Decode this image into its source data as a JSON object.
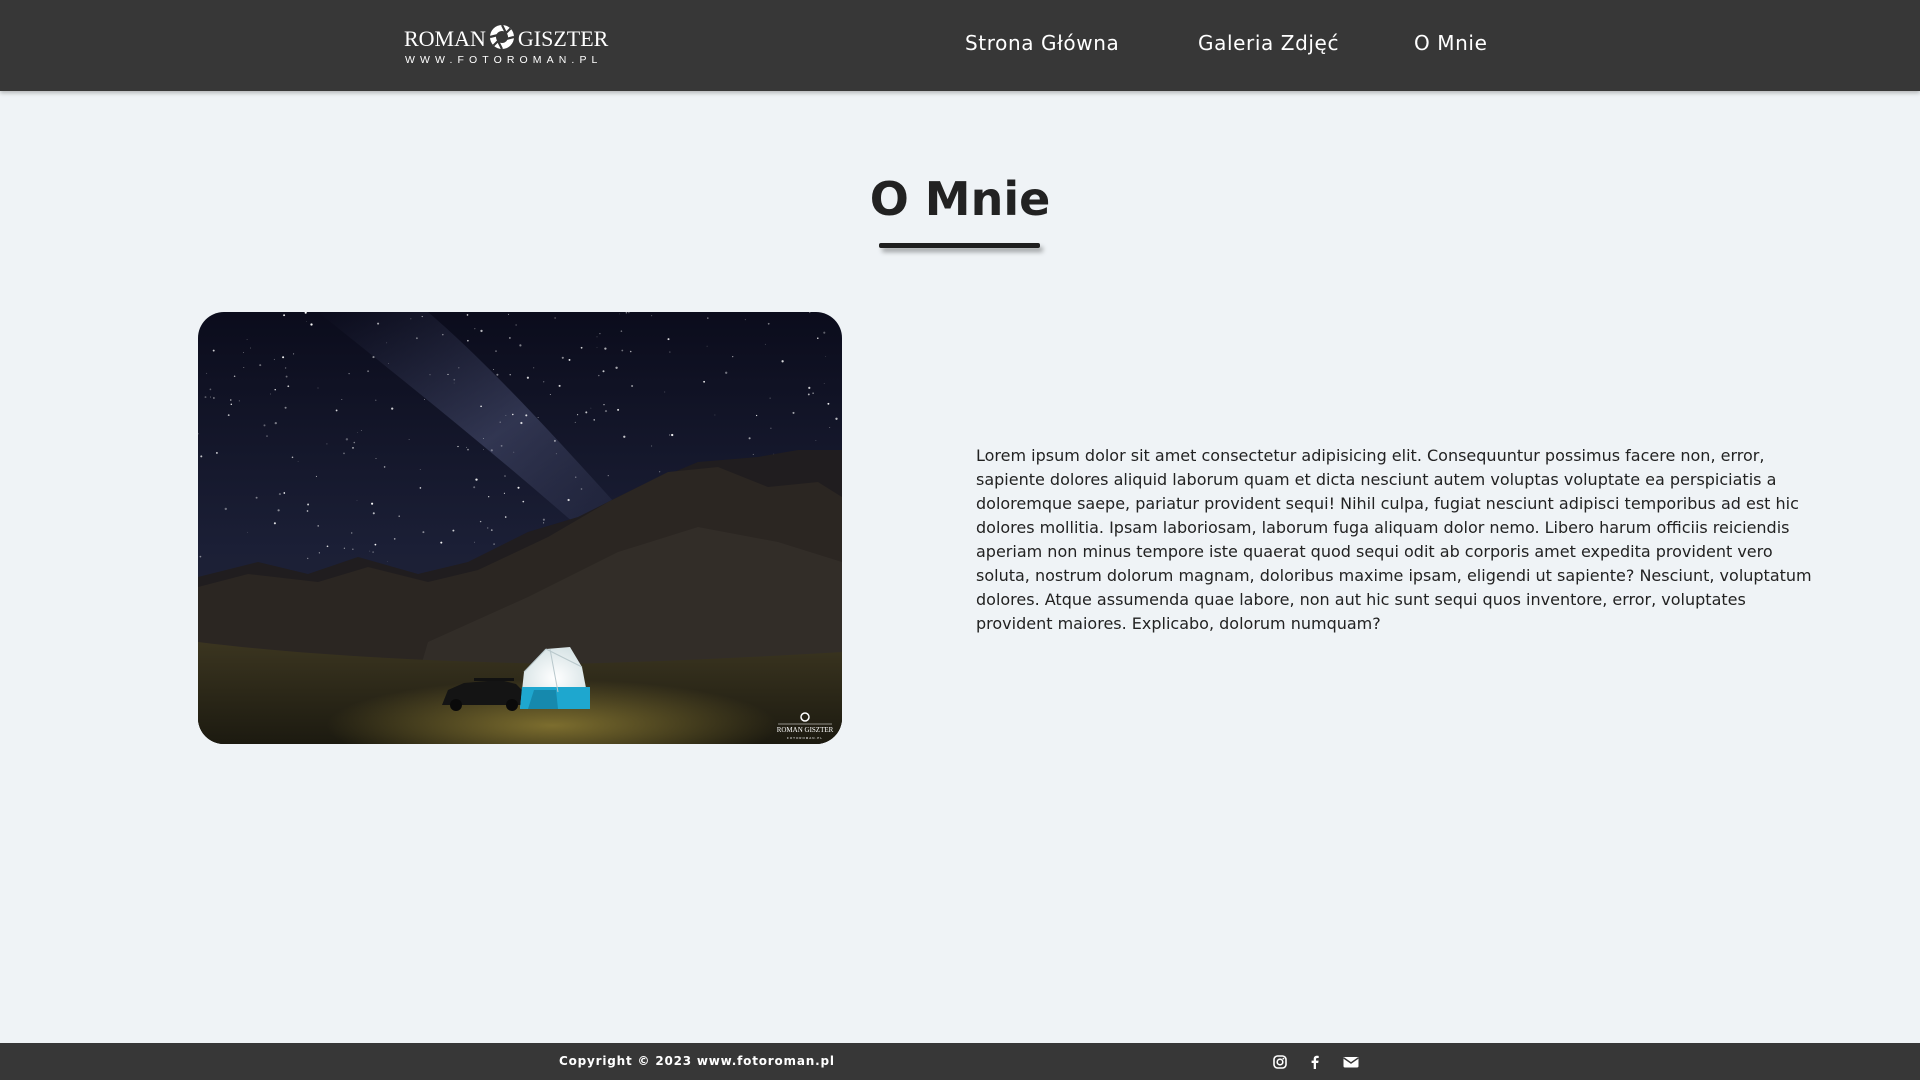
{
  "header": {
    "logo": {
      "name_left": "ROMAN",
      "name_right": "GISZTER",
      "url": "WWW.FOTOROMAN.PL",
      "mark_icon": "camera-aperture-icon"
    },
    "nav": [
      {
        "label": "Strona Główna"
      },
      {
        "label": "Galeria Zdjęć"
      },
      {
        "label": "O Mnie"
      }
    ]
  },
  "main": {
    "title": "O Mnie",
    "image": {
      "watermark_name": "ROMAN GISZTER",
      "watermark_url": "FOTOROMAN.PL"
    },
    "paragraph": "Lorem ipsum dolor sit amet consectetur adipisicing elit. Consequuntur possimus facere non, error, sapiente dolores aliquid laborum quam et dicta nesciunt autem voluptas voluptate ea perspiciatis a doloremque saepe, pariatur provident sequi! Nihil culpa, fugiat nesciunt adipisci temporibus ad est hic dolores mollitia. Ipsam laboriosam, laborum fuga aliquam dolor nemo. Libero harum officiis reiciendis aperiam non minus tempore iste quaerat quod sequi odit ab corporis amet expedita provident vero soluta, nostrum dolorum magnam, doloribus maxime ipsam, eligendi ut sapiente? Nesciunt, voluptatum dolores. Atque assumenda quae labore, non aut hic sunt sequi quos inventore, error, voluptates provident maiores. Explicabo, dolorum numquam?"
  },
  "footer": {
    "copyright": "Copyright © 2023 www.fotoroman.pl",
    "social": [
      {
        "icon": "instagram-icon"
      },
      {
        "icon": "facebook-icon"
      },
      {
        "icon": "envelope-icon"
      }
    ]
  },
  "colors": {
    "bar_background": "#373737",
    "page_background": "#eff3f6",
    "text": "#222222",
    "tent_blue": "#1ea7cf"
  }
}
